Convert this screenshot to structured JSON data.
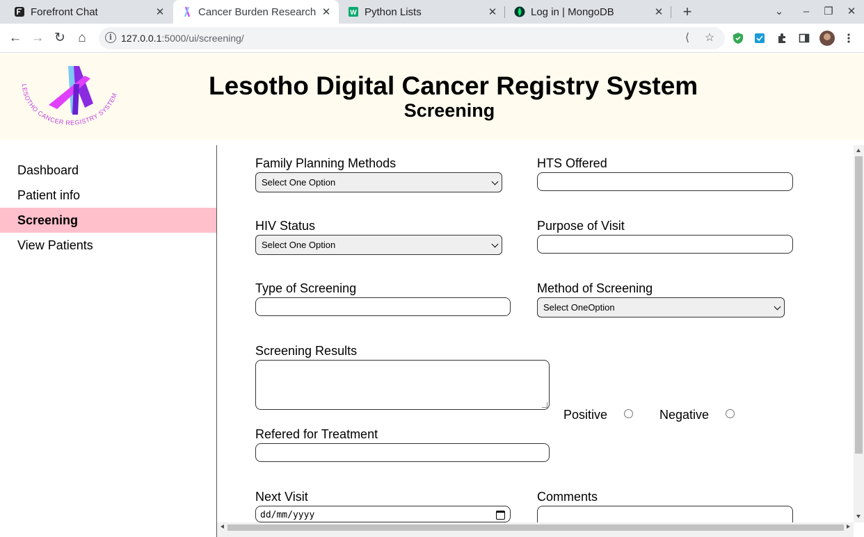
{
  "browser": {
    "tabs": [
      {
        "title": "Forefront Chat",
        "icon": "forefront-icon"
      },
      {
        "title": "Cancer Burden Research F",
        "icon": "ribbon-icon"
      },
      {
        "title": "Python Lists",
        "icon": "w3schools-icon"
      },
      {
        "title": "Log in | MongoDB",
        "icon": "mongodb-leaf-icon"
      }
    ],
    "active_tab": 1,
    "url_host": "127.0.0.1",
    "url_rest": ":5000/ui/screening/"
  },
  "header": {
    "site_title": "Lesotho Digital Cancer Registry System",
    "page_title": "Screening",
    "logo_text": "LESOTHO CANCER REGISTRY SYSTEM"
  },
  "sidebar": {
    "items": [
      {
        "label": "Dashboard"
      },
      {
        "label": "Patient info"
      },
      {
        "label": "Screening"
      },
      {
        "label": "View Patients"
      }
    ],
    "active_index": 2
  },
  "form": {
    "family_planning": {
      "label": "Family Planning Methods",
      "value": "Select One Option"
    },
    "hts_offered": {
      "label": "HTS Offered",
      "value": ""
    },
    "hiv_status": {
      "label": "HIV Status",
      "value": "Select One Option"
    },
    "purpose_of_visit": {
      "label": "Purpose of Visit",
      "value": ""
    },
    "type_of_screening": {
      "label": "Type of Screening",
      "value": ""
    },
    "method_of_screening": {
      "label": "Method of Screening",
      "value": "Select OneOption"
    },
    "screening_results": {
      "label": "Screening Results",
      "value": ""
    },
    "result_options": {
      "positive": "Positive",
      "negative": "Negative"
    },
    "referred_for_treatment": {
      "label": "Refered for Treatment",
      "value": ""
    },
    "next_visit": {
      "label": "Next Visit",
      "placeholder": "dd/mm/yyyy"
    },
    "comments": {
      "label": "Comments",
      "value": ""
    }
  },
  "colors": {
    "header_bg": "#fffbee",
    "active_nav_bg": "#ffc0cb",
    "logo_pink": "#e040fb",
    "logo_blue": "#7ec8f5",
    "logo_purple": "#8a2be2"
  }
}
